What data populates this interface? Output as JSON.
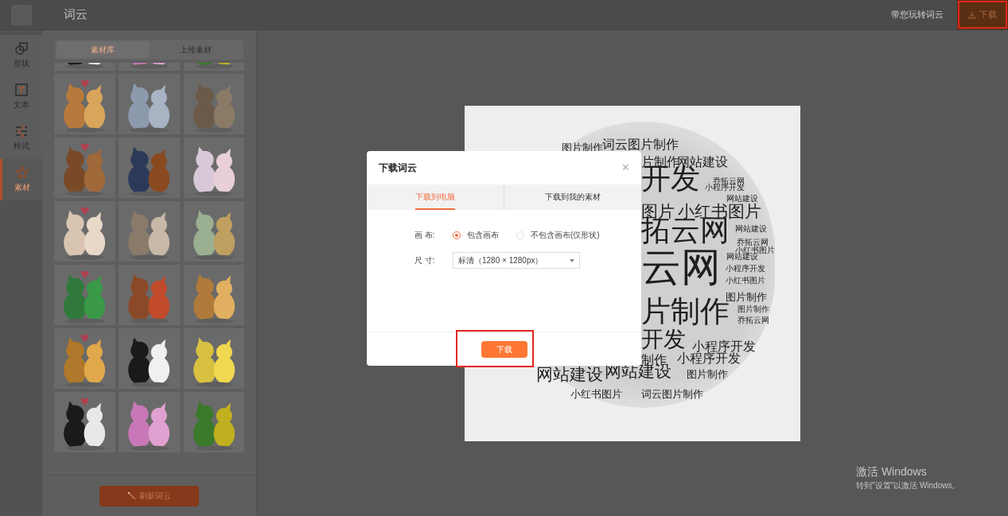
{
  "app": {
    "title": "词云",
    "guide_link": "带您玩转词云",
    "download_button": {
      "label": "下载",
      "highlighted": true
    }
  },
  "nav": [
    {
      "label": "形状",
      "selected": false
    },
    {
      "label": "文本",
      "selected": false
    },
    {
      "label": "样式",
      "selected": false
    },
    {
      "label": "素材",
      "selected": true
    }
  ],
  "material_panel": {
    "tabs": [
      {
        "label": "素材库",
        "selected": true
      },
      {
        "label": "上传素材",
        "selected": false
      }
    ],
    "refresh_button": "刷新词云"
  },
  "word_cloud": {
    "words": [
      {
        "text": "图片制作",
        "kind": "small"
      },
      {
        "text": "词云图片制作",
        "kind": "medium"
      },
      {
        "text": "片制作",
        "kind": "medium"
      },
      {
        "text": "网站建设",
        "kind": "medium"
      },
      {
        "text": "开发",
        "kind": "major"
      },
      {
        "text": "乔拓云网",
        "kind": "minor"
      },
      {
        "text": "小程序开发",
        "kind": "minor"
      },
      {
        "text": "网站建设",
        "kind": "minor"
      },
      {
        "text": "图片",
        "kind": "big"
      },
      {
        "text": "小红书图片",
        "kind": "big"
      },
      {
        "text": "拓云网",
        "kind": "major"
      },
      {
        "text": "网站建设",
        "kind": "minor"
      },
      {
        "text": "乔拓云网",
        "kind": "minor"
      },
      {
        "text": "小红书图片",
        "kind": "minor"
      },
      {
        "text": "网站建设",
        "kind": "minor"
      },
      {
        "text": "云网",
        "kind": "top"
      },
      {
        "text": "小程序开发",
        "kind": "minor"
      },
      {
        "text": "小红书图片",
        "kind": "minor"
      },
      {
        "text": "图片制作",
        "kind": "small"
      },
      {
        "text": "图片制作",
        "kind": "minor"
      },
      {
        "text": "乔拓云网",
        "kind": "minor"
      },
      {
        "text": "片制作",
        "kind": "major"
      },
      {
        "text": "开发",
        "kind": "bigger"
      },
      {
        "text": "小程序开发",
        "kind": "medium"
      },
      {
        "text": "制作",
        "kind": "medium"
      },
      {
        "text": "小程序开发",
        "kind": "medium"
      },
      {
        "text": "网站建设",
        "kind": "big"
      },
      {
        "text": "网站建设",
        "kind": "big"
      },
      {
        "text": "图片制作",
        "kind": "small"
      },
      {
        "text": "小红书图片",
        "kind": "small"
      },
      {
        "text": "词云图片制作",
        "kind": "small"
      }
    ]
  },
  "dialog": {
    "title": "下载词云",
    "close": "×",
    "tabs": [
      {
        "label": "下载到电脑",
        "selected": true
      },
      {
        "label": "下载到我的素材",
        "selected": false
      }
    ],
    "canvas_label": "画 布:",
    "canvas_options": [
      {
        "label": "包含画布",
        "selected": true
      },
      {
        "label": "不包含画布(仅形状)",
        "selected": false
      }
    ],
    "size_label": "尺 寸:",
    "size_value": "标清（1280 × 1280px）",
    "download_button": {
      "label": "下载",
      "highlighted": true
    }
  },
  "activation_notice": {
    "title": "激活 Windows",
    "subtitle": "转到\"设置\"以激活 Windows。"
  }
}
